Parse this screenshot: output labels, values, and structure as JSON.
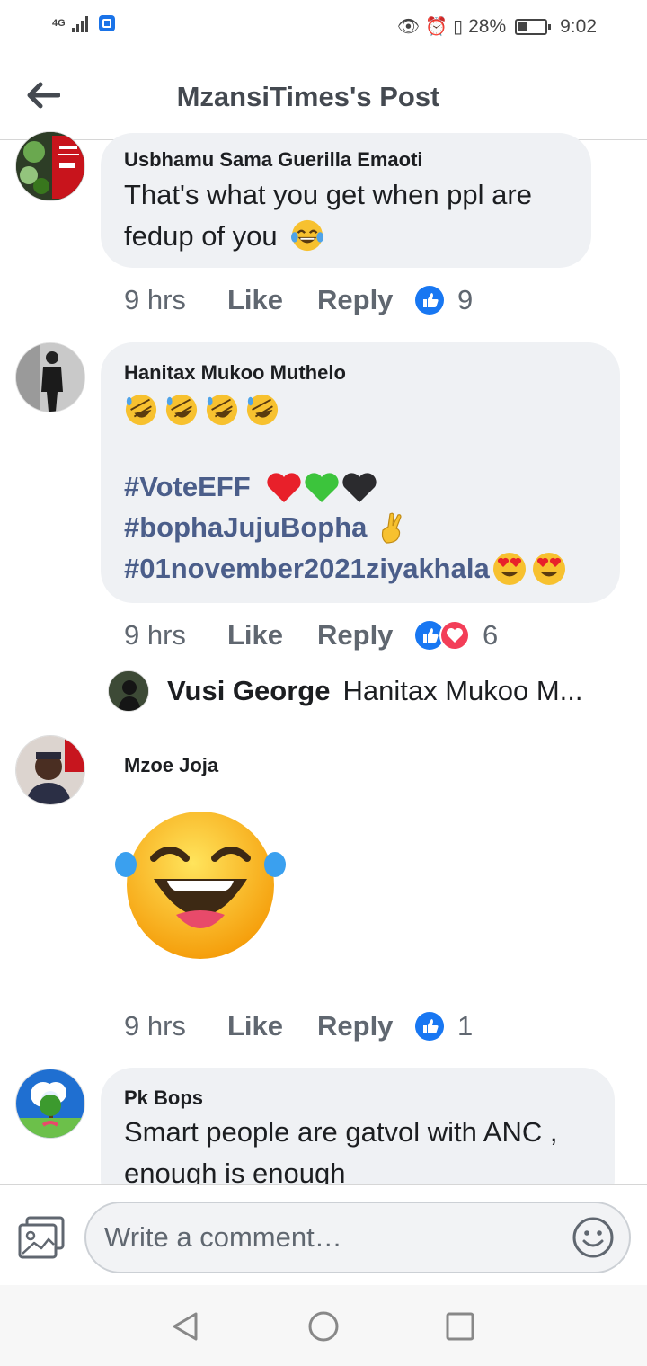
{
  "status_bar": {
    "network": "4G",
    "battery": "28%",
    "time": "9:02"
  },
  "header": {
    "title": "MzansiTimes's Post"
  },
  "comments": [
    {
      "author": "Usbhamu Sama Guerilla Emaoti",
      "lines": [
        "That's what you get when ppl are",
        "fedup of you"
      ],
      "time": "9 hrs",
      "like_label": "Like",
      "reply_label": "Reply",
      "reaction_count": "9"
    },
    {
      "author": "Hanitax Mukoo Muthelo",
      "hashtags": [
        "#VoteEFF",
        "#bophaJujuBopha",
        "#01november2021ziyakhala"
      ],
      "time": "9 hrs",
      "like_label": "Like",
      "reply_label": "Reply",
      "reaction_count": "6"
    },
    {
      "author": "Mzoe Joja",
      "time": "9 hrs",
      "like_label": "Like",
      "reply_label": "Reply",
      "reaction_count": "1"
    },
    {
      "author": "Pk Bops",
      "lines": [
        "Smart people are gatvol with ANC ,",
        "enough is enough"
      ]
    }
  ],
  "reply_preview": {
    "author": "Vusi George",
    "text": "Hanitax Mukoo M..."
  },
  "composer": {
    "placeholder": "Write a comment…"
  },
  "colors": {
    "bubble": "#eff1f4",
    "hashtag": "#4b5e8a",
    "like_blue": "#1877f2",
    "love_red": "#f33e58"
  }
}
